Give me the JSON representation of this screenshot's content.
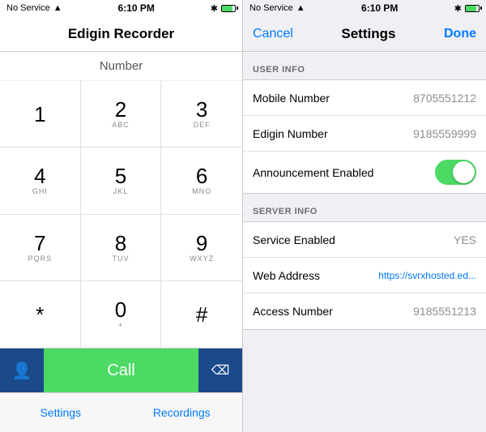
{
  "left": {
    "status": {
      "no_service": "No Service",
      "time": "6:10 PM"
    },
    "title": "Edigin Recorder",
    "number_label": "Number",
    "dialpad": [
      {
        "digit": "1",
        "letters": ""
      },
      {
        "digit": "2",
        "letters": "ABC"
      },
      {
        "digit": "3",
        "letters": "DEF"
      },
      {
        "digit": "4",
        "letters": "GHI"
      },
      {
        "digit": "5",
        "letters": "JKL"
      },
      {
        "digit": "6",
        "letters": "MNO"
      },
      {
        "digit": "7",
        "letters": "PQRS"
      },
      {
        "digit": "8",
        "letters": "TUV"
      },
      {
        "digit": "9",
        "letters": "WXYZ"
      },
      {
        "digit": "*",
        "letters": ""
      },
      {
        "digit": "0",
        "letters": "+"
      },
      {
        "digit": "#",
        "letters": ""
      }
    ],
    "call_label": "Call",
    "tabs": [
      {
        "label": "Settings"
      },
      {
        "label": "Recordings"
      }
    ]
  },
  "right": {
    "status": {
      "no_service": "No Service",
      "time": "6:10 PM"
    },
    "nav": {
      "cancel": "Cancel",
      "title": "Settings",
      "done": "Done"
    },
    "sections": [
      {
        "header": "USER INFO",
        "rows": [
          {
            "label": "Mobile Number",
            "value": "8705551212",
            "type": "text"
          },
          {
            "label": "Edigin Number",
            "value": "9185559999",
            "type": "text"
          },
          {
            "label": "Announcement Enabled",
            "value": "",
            "type": "toggle",
            "toggle_on": true
          }
        ]
      },
      {
        "header": "SERVER INFO",
        "rows": [
          {
            "label": "Service Enabled",
            "value": "YES",
            "type": "text"
          },
          {
            "label": "Web Address",
            "value": "https://svrxhosted.ed...",
            "type": "text"
          },
          {
            "label": "Access Number",
            "value": "9185551213",
            "type": "text"
          }
        ]
      }
    ]
  }
}
